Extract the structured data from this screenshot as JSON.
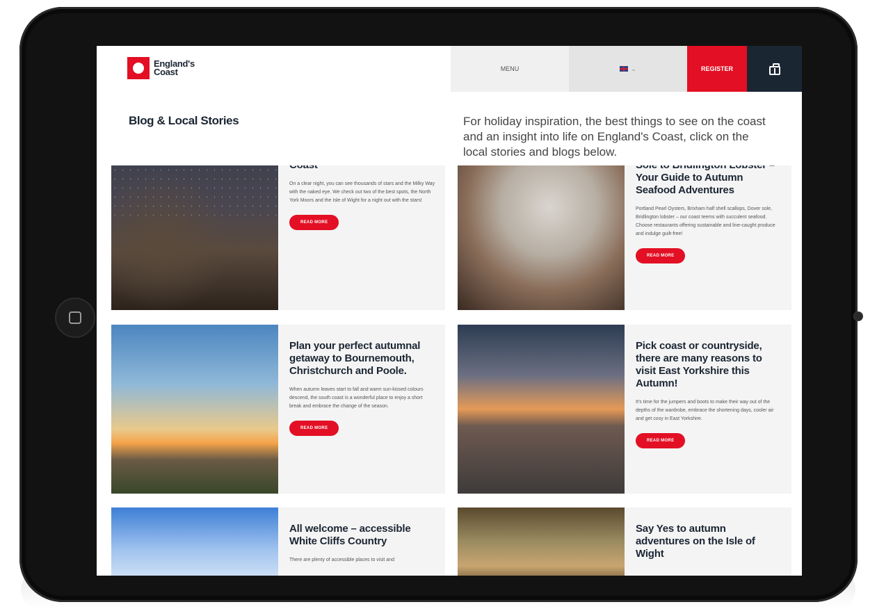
{
  "logo": {
    "line1": "England's",
    "line2": "Coast"
  },
  "nav": {
    "menu": "MENU",
    "lang": "⌄",
    "register": "REGISTER"
  },
  "page": {
    "title": "Blog & Local Stories",
    "intro": "For holiday inspiration, the best things to see on the coast and an insight into life on England's Coast, click on the local stories and blogs below."
  },
  "cards": [
    {
      "title": "Coast",
      "text": "On a clear night, you can see thousands of stars and the Milky Way with the naked eye. We check out two of the best spots, the North York Moors and the Isle of Wight for a night out with the stars!",
      "button": "READ MORE"
    },
    {
      "title": "Sole to Bridlington Lobster – Your Guide to Autumn Seafood Adventures",
      "text": "Portland Pearl Oysters, Brixham half shell scallops, Dover sole, Bridlington lobster – our coast teems with succulent seafood. Choose restaurants offering sustainable and line-caught produce and indulge guilt-free!",
      "button": "READ MORE"
    },
    {
      "title": "Plan your perfect autumnal getaway to Bournemouth, Christchurch and Poole.",
      "text": "When autumn leaves start to fall and warm sun-kissed colours descend, the south coast is a wonderful place to enjoy a short break and embrace the change of the season.",
      "button": "READ MORE"
    },
    {
      "title": "Pick coast or countryside, there are many reasons to visit East Yorkshire this Autumn!",
      "text": "It's time for the jumpers and boots to make their way out of the depths of the wardrobe, embrace the shortening days, cooler air and get cosy in East Yorkshire.",
      "button": "READ MORE"
    },
    {
      "title": "All welcome – accessible White Cliffs Country",
      "text": "There are plenty of accessible places to visit and"
    },
    {
      "title": "Say Yes to autumn adventures on the Isle of Wight"
    }
  ]
}
